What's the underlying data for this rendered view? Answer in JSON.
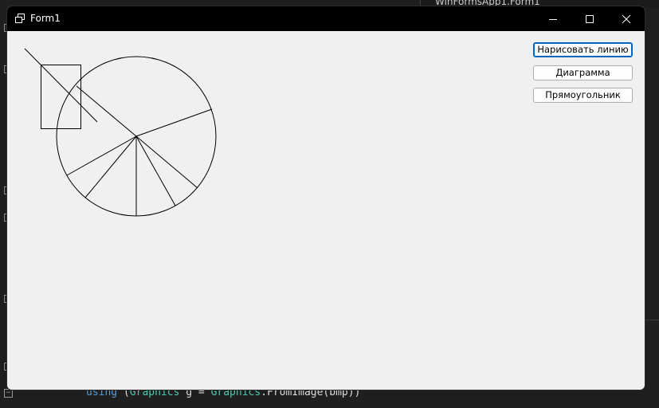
{
  "window": {
    "title": "Form1"
  },
  "buttons": {
    "draw_line": "Нарисовать линию",
    "diagram": "Диаграмма",
    "rectangle": "Прямоугольник"
  },
  "ide": {
    "tab_title": "WinFormsApp1.Form1",
    "code": {
      "keyword": "using",
      "open_paren": " (",
      "type1": "Graphics",
      "var": " g = ",
      "type2": "Graphics",
      "rest": ".FromImage(bmp))"
    }
  },
  "icons": {
    "app": "window-app-icon",
    "minimize": "minimize-icon",
    "maximize": "maximize-icon",
    "close": "close-icon"
  },
  "colors": {
    "titlebar": "#000000",
    "form_background": "#f0f0f0",
    "default_button_border": "#0067c0"
  }
}
